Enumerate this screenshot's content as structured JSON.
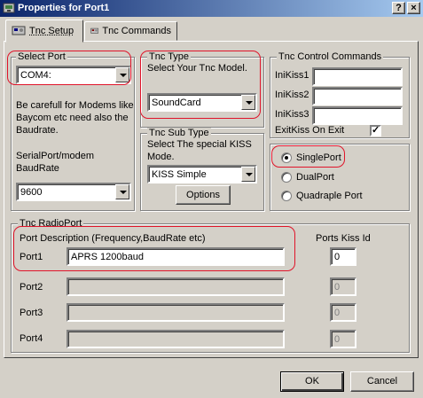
{
  "window": {
    "title": "Properties for Port1",
    "help_button": "?",
    "close_button": "×"
  },
  "tabs": [
    {
      "label": "Tnc Setup",
      "icon": "tnc-setup-icon"
    },
    {
      "label": "Tnc Commands",
      "icon": "tnc-commands-icon"
    }
  ],
  "select_port": {
    "legend": "Select Port",
    "value": "COM4:",
    "note_line1": "Be carefull for Modems like",
    "note_line2": "Baycom etc need also the",
    "note_line3": "Baudrate.",
    "baud_label_line1": "SerialPort/modem",
    "baud_label_line2": "BaudRate",
    "baud_value": "9600"
  },
  "tnc_type": {
    "legend": "Tnc Type",
    "prompt": "Select Your Tnc Model.",
    "value": "SoundCard"
  },
  "tnc_sub_type": {
    "legend": "Tnc Sub Type",
    "prompt_line1": "Select The special KISS",
    "prompt_line2": "Mode.",
    "value": "KISS Simple",
    "options_button": "Options"
  },
  "tnc_control": {
    "legend": "Tnc Control Commands",
    "inikiss1_label": "IniKiss1",
    "inikiss1_value": "",
    "inikiss2_label": "IniKiss2",
    "inikiss2_value": "",
    "inikiss3_label": "IniKiss3",
    "inikiss3_value": "",
    "exitkiss_label": "ExitKiss On Exit",
    "exitkiss_checked": "✓"
  },
  "port_mode": {
    "single": "SinglePort",
    "dual": "DualPort",
    "quad": "Quadraple Port",
    "selected": "SinglePort"
  },
  "radioport": {
    "legend": "Tnc RadioPort",
    "desc_header": "Port Description (Frequency,BaudRate etc)",
    "kiss_header": "Ports Kiss Id",
    "ports": [
      {
        "label": "Port1",
        "description": "APRS 1200baud",
        "kiss_id": "0"
      },
      {
        "label": "Port2",
        "description": "",
        "kiss_id": "0"
      },
      {
        "label": "Port3",
        "description": "",
        "kiss_id": "0"
      },
      {
        "label": "Port4",
        "description": "",
        "kiss_id": "0"
      }
    ]
  },
  "footer": {
    "ok": "OK",
    "cancel": "Cancel"
  },
  "colors": {
    "titlebar": "#0a246a",
    "highlight": "#e0142a",
    "face": "#d4d0c8"
  }
}
